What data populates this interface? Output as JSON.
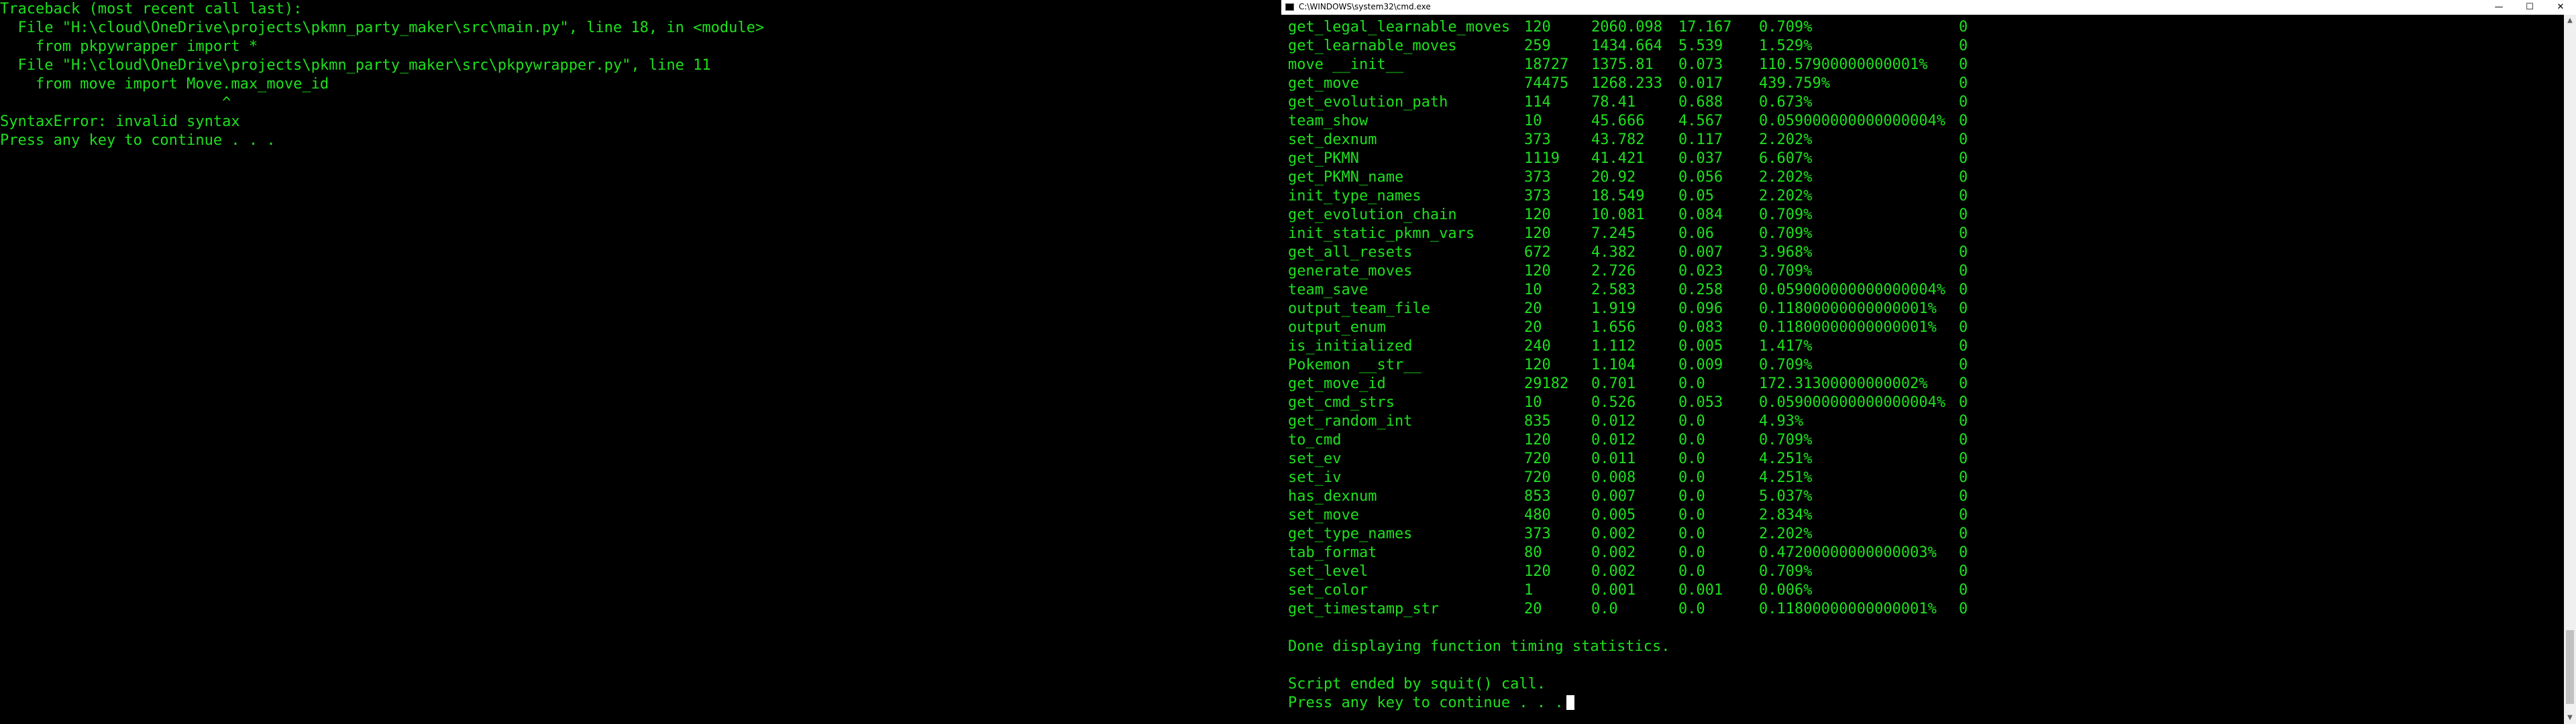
{
  "left_console": {
    "lines": [
      "Traceback (most recent call last):",
      "  File \"H:\\cloud\\OneDrive\\projects\\pkmn_party_maker\\src\\main.py\", line 18, in <module>",
      "    from pkpywrapper import *",
      "  File \"H:\\cloud\\OneDrive\\projects\\pkmn_party_maker\\src\\pkpywrapper.py\", line 11",
      "    from move import Move.max_move_id",
      "                         ^",
      "SyntaxError: invalid syntax",
      "Press any key to continue . . ."
    ]
  },
  "right_window": {
    "title": "C:\\WINDOWS\\system32\\cmd.exe",
    "controls": {
      "minimize": "—",
      "maximize": "☐",
      "close": "✕"
    },
    "stats": [
      {
        "name": "get_legal_learnable_moves",
        "calls": "120",
        "total": "2060.098",
        "avg": "17.167",
        "pct": "0.709%",
        "last": "0"
      },
      {
        "name": "get_learnable_moves",
        "calls": "259",
        "total": "1434.664",
        "avg": "5.539",
        "pct": "1.529%",
        "last": "0"
      },
      {
        "name": "move __init__",
        "calls": "18727",
        "total": "1375.81",
        "avg": "0.073",
        "pct": "110.57900000000001%",
        "last": "0"
      },
      {
        "name": "get_move",
        "calls": "74475",
        "total": "1268.233",
        "avg": "0.017",
        "pct": "439.759%",
        "last": "0"
      },
      {
        "name": "get_evolution_path",
        "calls": "114",
        "total": "78.41",
        "avg": "0.688",
        "pct": "0.673%",
        "last": "0"
      },
      {
        "name": "team_show",
        "calls": "10",
        "total": "45.666",
        "avg": "4.567",
        "pct": "0.059000000000000004%",
        "last": "0"
      },
      {
        "name": "set_dexnum",
        "calls": "373",
        "total": "43.782",
        "avg": "0.117",
        "pct": "2.202%",
        "last": "0"
      },
      {
        "name": "get_PKMN",
        "calls": "1119",
        "total": "41.421",
        "avg": "0.037",
        "pct": "6.607%",
        "last": "0"
      },
      {
        "name": "get_PKMN_name",
        "calls": "373",
        "total": "20.92",
        "avg": "0.056",
        "pct": "2.202%",
        "last": "0"
      },
      {
        "name": "init_type_names",
        "calls": "373",
        "total": "18.549",
        "avg": "0.05",
        "pct": "2.202%",
        "last": "0"
      },
      {
        "name": "get_evolution_chain",
        "calls": "120",
        "total": "10.081",
        "avg": "0.084",
        "pct": "0.709%",
        "last": "0"
      },
      {
        "name": "init_static_pkmn_vars",
        "calls": "120",
        "total": "7.245",
        "avg": "0.06",
        "pct": "0.709%",
        "last": "0"
      },
      {
        "name": "get_all_resets",
        "calls": "672",
        "total": "4.382",
        "avg": "0.007",
        "pct": "3.968%",
        "last": "0"
      },
      {
        "name": "generate_moves",
        "calls": "120",
        "total": "2.726",
        "avg": "0.023",
        "pct": "0.709%",
        "last": "0"
      },
      {
        "name": "team_save",
        "calls": "10",
        "total": "2.583",
        "avg": "0.258",
        "pct": "0.059000000000000004%",
        "last": "0"
      },
      {
        "name": "output_team_file",
        "calls": "20",
        "total": "1.919",
        "avg": "0.096",
        "pct": "0.11800000000000001%",
        "last": "0"
      },
      {
        "name": "output_enum",
        "calls": "20",
        "total": "1.656",
        "avg": "0.083",
        "pct": "0.11800000000000001%",
        "last": "0"
      },
      {
        "name": "is_initialized",
        "calls": "240",
        "total": "1.112",
        "avg": "0.005",
        "pct": "1.417%",
        "last": "0"
      },
      {
        "name": "Pokemon __str__",
        "calls": "120",
        "total": "1.104",
        "avg": "0.009",
        "pct": "0.709%",
        "last": "0"
      },
      {
        "name": "get_move_id",
        "calls": "29182",
        "total": "0.701",
        "avg": "0.0",
        "pct": "172.31300000000002%",
        "last": "0"
      },
      {
        "name": "get_cmd_strs",
        "calls": "10",
        "total": "0.526",
        "avg": "0.053",
        "pct": "0.059000000000000004%",
        "last": "0"
      },
      {
        "name": "get_random_int",
        "calls": "835",
        "total": "0.012",
        "avg": "0.0",
        "pct": "4.93%",
        "last": "0"
      },
      {
        "name": "to_cmd",
        "calls": "120",
        "total": "0.012",
        "avg": "0.0",
        "pct": "0.709%",
        "last": "0"
      },
      {
        "name": "set_ev",
        "calls": "720",
        "total": "0.011",
        "avg": "0.0",
        "pct": "4.251%",
        "last": "0"
      },
      {
        "name": "set_iv",
        "calls": "720",
        "total": "0.008",
        "avg": "0.0",
        "pct": "4.251%",
        "last": "0"
      },
      {
        "name": "has_dexnum",
        "calls": "853",
        "total": "0.007",
        "avg": "0.0",
        "pct": "5.037%",
        "last": "0"
      },
      {
        "name": "set_move",
        "calls": "480",
        "total": "0.005",
        "avg": "0.0",
        "pct": "2.834%",
        "last": "0"
      },
      {
        "name": "get_type_names",
        "calls": "373",
        "total": "0.002",
        "avg": "0.0",
        "pct": "2.202%",
        "last": "0"
      },
      {
        "name": "tab_format",
        "calls": "80",
        "total": "0.002",
        "avg": "0.0",
        "pct": "0.47200000000000003%",
        "last": "0"
      },
      {
        "name": "set_level",
        "calls": "120",
        "total": "0.002",
        "avg": "0.0",
        "pct": "0.709%",
        "last": "0"
      },
      {
        "name": "set_color",
        "calls": "1",
        "total": "0.001",
        "avg": "0.001",
        "pct": "0.006%",
        "last": "0"
      },
      {
        "name": "get_timestamp_str",
        "calls": "20",
        "total": "0.0",
        "avg": "0.0",
        "pct": "0.11800000000000001%",
        "last": "0"
      }
    ],
    "done_message": "Done displaying function timing statistics.",
    "script_message": "Script ended by squit() call.",
    "prompt_message": "Press any key to continue . . .",
    "scrollbar": {
      "up_arrow": "▲",
      "down_arrow": "▼"
    }
  },
  "colors": {
    "terminal_text": "#1ee01e",
    "background": "#000000",
    "titlebar": "#ffffff"
  }
}
